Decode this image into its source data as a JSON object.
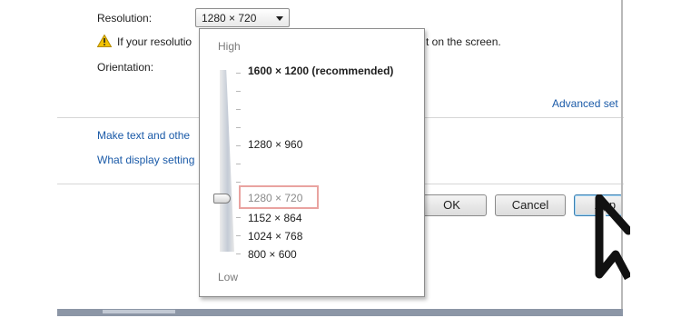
{
  "resolution": {
    "label": "Resolution:",
    "selected": "1280 × 720"
  },
  "warning": {
    "text_left": "If your resolutio",
    "text_right": "t on the screen."
  },
  "orientation": {
    "label": "Orientation:"
  },
  "links": {
    "advanced": "Advanced set",
    "make_text": "Make text and othe",
    "what_display": "What display setting"
  },
  "buttons": {
    "ok": "OK",
    "cancel": "Cancel",
    "apply": "App"
  },
  "popup": {
    "high_label": "High",
    "low_label": "Low",
    "options": [
      {
        "text": "1600 × 1200 (recommended)"
      },
      {
        "text": "1280 × 960"
      },
      {
        "text": "1280 × 720"
      },
      {
        "text": "1152 × 864"
      },
      {
        "text": "1024 × 768"
      },
      {
        "text": "800 × 600"
      }
    ],
    "selected_index": 2
  },
  "colors": {
    "link": "#1a5aa8",
    "highlight": "#e9a3a0"
  },
  "icons": {
    "warning": "warning-icon",
    "dropdown": "chevron-down-icon",
    "cursor": "mouse-pointer-icon"
  }
}
